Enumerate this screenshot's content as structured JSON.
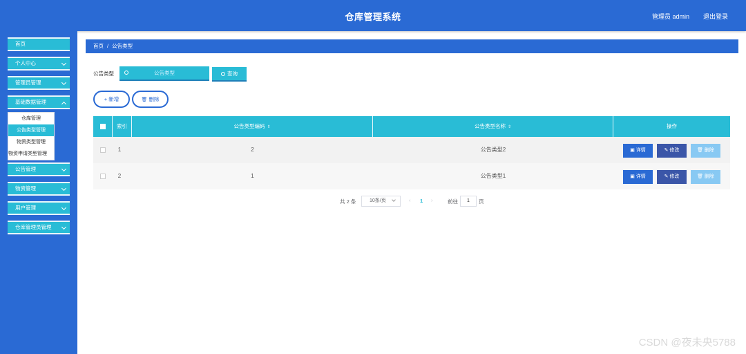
{
  "header": {
    "title": "仓库管理系统",
    "user": "管理员 admin",
    "logout": "退出登录"
  },
  "sidebar": {
    "items": [
      {
        "label": "首页"
      },
      {
        "label": "个人中心"
      },
      {
        "label": "管理员管理"
      },
      {
        "label": "基础数据管理"
      },
      {
        "label": "公告管理"
      },
      {
        "label": "物资管理"
      },
      {
        "label": "用户管理"
      },
      {
        "label": "仓库管理员管理"
      }
    ],
    "submenu": [
      "仓库管理",
      "公告类型管理",
      "物资类型管理",
      "物资申请类型管理"
    ]
  },
  "breadcrumb": {
    "home": "首页",
    "separator": "/",
    "current": "公告类型"
  },
  "search": {
    "label": "公告类型",
    "placeholder": "公告类型",
    "button": "查询"
  },
  "actions": {
    "add": "+ 新增",
    "delete": "删除"
  },
  "table": {
    "columns": [
      "索引",
      "公告类型编码",
      "公告类型名称",
      "操作"
    ],
    "rows": [
      {
        "index": "1",
        "code": "2",
        "name": "公告类型2"
      },
      {
        "index": "2",
        "code": "1",
        "name": "公告类型1"
      }
    ],
    "row_actions": {
      "detail": "详情",
      "edit": "修改",
      "delete": "删除"
    }
  },
  "pagination": {
    "total": "共 2 条",
    "page_size": "10条/页",
    "current": "1",
    "goto_prefix": "前往",
    "goto_value": "1",
    "goto_suffix": "页"
  },
  "watermark": "CSDN @夜未央5788",
  "colors": {
    "primary": "#2a6ad4",
    "accent": "#29bcd6",
    "edit": "#3b56a8",
    "delete": "#88c9f3"
  }
}
